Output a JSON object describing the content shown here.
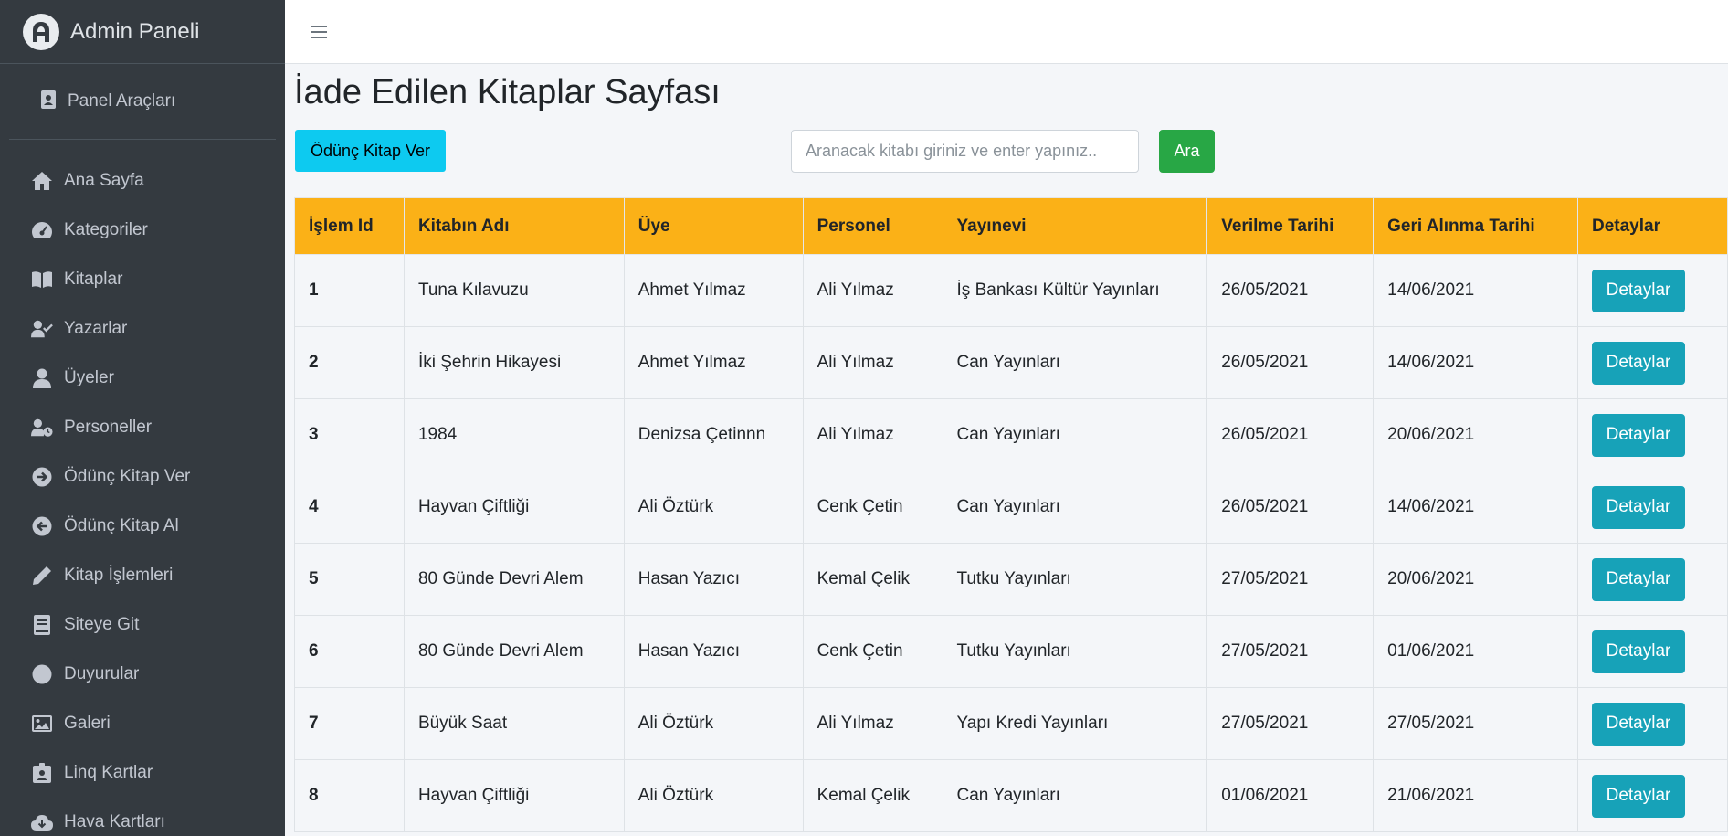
{
  "brand": {
    "title": "Admin Paneli",
    "logo_letter": "A"
  },
  "sidebar": {
    "panel_tools": "Panel Araçları",
    "items": [
      {
        "label": "Ana Sayfa",
        "icon": "home-icon"
      },
      {
        "label": "Kategoriler",
        "icon": "gauge-icon"
      },
      {
        "label": "Kitaplar",
        "icon": "book-open-icon"
      },
      {
        "label": "Yazarlar",
        "icon": "user-check-icon"
      },
      {
        "label": "Üyeler",
        "icon": "user-icon"
      },
      {
        "label": "Personeller",
        "icon": "user-clock-icon"
      },
      {
        "label": "Ödünç Kitap Ver",
        "icon": "arrow-circle-right-icon"
      },
      {
        "label": "Ödünç Kitap Al",
        "icon": "arrow-circle-left-icon"
      },
      {
        "label": "Kitap İşlemleri",
        "icon": "pencil-icon"
      },
      {
        "label": "Siteye Git",
        "icon": "book-icon"
      },
      {
        "label": "Duyurular",
        "icon": "circle-icon"
      },
      {
        "label": "Galeri",
        "icon": "image-icon"
      },
      {
        "label": "Linq Kartlar",
        "icon": "id-badge-icon"
      },
      {
        "label": "Hava Kartları",
        "icon": "cloud-download-icon"
      }
    ]
  },
  "page": {
    "title": "İade Edilen Kitaplar Sayfası",
    "lend_button": "Ödünç Kitap Ver",
    "search_placeholder": "Aranacak kitabı giriniz ve enter yapınız..",
    "search_button": "Ara"
  },
  "table": {
    "headers": [
      "İşlem Id",
      "Kitabın Adı",
      "Üye",
      "Personel",
      "Yayınevi",
      "Verilme Tarihi",
      "Geri Alınma Tarihi",
      "Detaylar"
    ],
    "detail_label": "Detaylar",
    "rows": [
      {
        "id": "1",
        "book": "Tuna Kılavuzu",
        "member": "Ahmet Yılmaz",
        "staff": "Ali Yılmaz",
        "publisher": "İş Bankası Kültür Yayınları",
        "given": "26/05/2021",
        "returned": "14/06/2021"
      },
      {
        "id": "2",
        "book": "İki Şehrin Hikayesi",
        "member": "Ahmet Yılmaz",
        "staff": "Ali Yılmaz",
        "publisher": "Can Yayınları",
        "given": "26/05/2021",
        "returned": "14/06/2021"
      },
      {
        "id": "3",
        "book": "1984",
        "member": "Denizsa Çetinnn",
        "staff": "Ali Yılmaz",
        "publisher": "Can Yayınları",
        "given": "26/05/2021",
        "returned": "20/06/2021"
      },
      {
        "id": "4",
        "book": "Hayvan Çiftliği",
        "member": "Ali Öztürk",
        "staff": "Cenk Çetin",
        "publisher": "Can Yayınları",
        "given": "26/05/2021",
        "returned": "14/06/2021"
      },
      {
        "id": "5",
        "book": "80 Günde Devri Alem",
        "member": "Hasan Yazıcı",
        "staff": "Kemal Çelik",
        "publisher": "Tutku Yayınları",
        "given": "27/05/2021",
        "returned": "20/06/2021"
      },
      {
        "id": "6",
        "book": "80 Günde Devri Alem",
        "member": "Hasan Yazıcı",
        "staff": "Cenk Çetin",
        "publisher": "Tutku Yayınları",
        "given": "27/05/2021",
        "returned": "01/06/2021"
      },
      {
        "id": "7",
        "book": "Büyük Saat",
        "member": "Ali Öztürk",
        "staff": "Ali Yılmaz",
        "publisher": "Yapı Kredi Yayınları",
        "given": "27/05/2021",
        "returned": "27/05/2021"
      },
      {
        "id": "8",
        "book": "Hayvan Çiftliği",
        "member": "Ali Öztürk",
        "staff": "Kemal Çelik",
        "publisher": "Can Yayınları",
        "given": "01/06/2021",
        "returned": "21/06/2021"
      }
    ]
  },
  "colors": {
    "sidebar_bg": "#343a40",
    "table_header_bg": "#fbb117",
    "lend_button": "#0dcaf0",
    "search_button": "#28a745",
    "detail_button": "#17a2b8"
  }
}
